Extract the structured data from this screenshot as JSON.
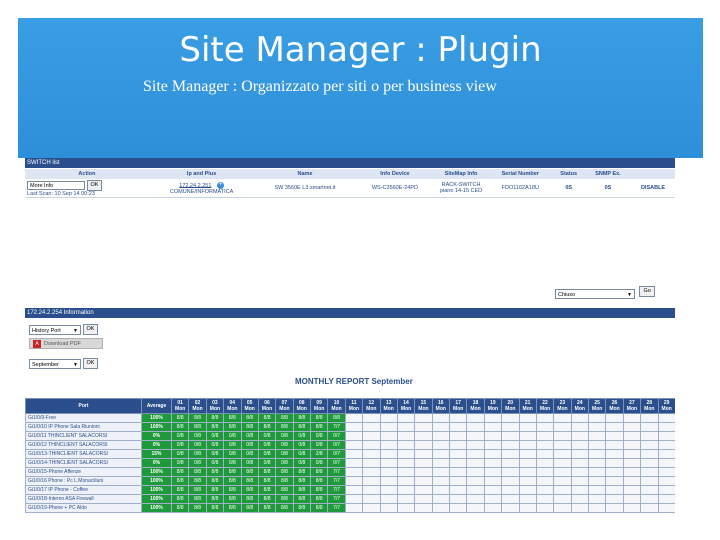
{
  "slide": {
    "title": "Site Manager : Plugin",
    "subtitle": "Site Manager   : Organizzato per siti o per business view"
  },
  "device_panel": {
    "title": "SWITCH list",
    "headers": [
      "Action",
      "Ip and Plus",
      "Name",
      "Info Device",
      "SiteMap Info",
      "Serial Number",
      "Status",
      "SNMP Ex.",
      ""
    ],
    "row": {
      "action_select": "More Info",
      "ok_label": "OK",
      "last_scan": "Last Scan: 10 Sep 14  00:23",
      "ip": "172.24.2.251",
      "ip_sub": "COMUNE/INFORMATICA",
      "name": "SW 3560E L3.smartnet.it",
      "info_device": "WS-C3560E-24PD",
      "sitemap_info": "RACK-SWITCH piano 14-15 CED",
      "serial": "FDO1102A18U",
      "status": "0S",
      "snmp": "0S",
      "extra": "DISABLE"
    },
    "group_select": "Chiuso",
    "go_label": "Go"
  },
  "info_panel": {
    "title": "172.24.2.254 Information",
    "history_select": "History Port",
    "history_ok": "OK",
    "pdf_label": "Download PDF",
    "month_select": "September",
    "month_ok": "OK",
    "report_title": "MONTHLY REPORT   September",
    "port_header": "Port",
    "avg_header": "Average",
    "days": [
      "01",
      "02",
      "03",
      "04",
      "05",
      "06",
      "07",
      "08",
      "09",
      "10",
      "11",
      "12",
      "13",
      "14",
      "15",
      "16",
      "17",
      "18",
      "19",
      "20",
      "21",
      "22",
      "23",
      "24",
      "25",
      "26",
      "27",
      "28",
      "29"
    ],
    "day_sub": "Mon",
    "rows": [
      {
        "port": "Gi1/0/9-Free",
        "avg": "100%",
        "vals": [
          "8/8",
          "8/8",
          "8/8",
          "8/8",
          "8/8",
          "8/8",
          "8/8",
          "8/8",
          "8/8",
          "8/8"
        ]
      },
      {
        "port": "Gi1/0/10 IP Phone Sala Riunioni",
        "avg": "100%",
        "vals": [
          "8/8",
          "8/8",
          "8/8",
          "8/8",
          "8/8",
          "8/8",
          "8/8",
          "8/8",
          "8/8",
          "7/7"
        ]
      },
      {
        "port": "Gi1/0/11 THINCLIENT SALACORSI",
        "avg": "0%",
        "vals": [
          "0/8",
          "0/8",
          "0/8",
          "0/8",
          "0/8",
          "0/8",
          "0/8",
          "0/8",
          "0/8",
          "0/7"
        ]
      },
      {
        "port": "Gi1/0/12 THINCLIENT SALACORSI",
        "avg": "0%",
        "vals": [
          "0/8",
          "0/8",
          "0/8",
          "0/8",
          "0/8",
          "0/8",
          "0/8",
          "0/8",
          "0/8",
          "0/7"
        ]
      },
      {
        "port": "Gi1/0/13-THINCLIENT SALACORSI",
        "avg": "15%",
        "vals": [
          "0/8",
          "0/8",
          "0/8",
          "0/8",
          "0/8",
          "0/8",
          "0/8",
          "0/8",
          "2/8",
          "0/7"
        ]
      },
      {
        "port": "Gi1/0/14-THINCLIENT SALACORSI",
        "avg": "0%",
        "vals": [
          "0/8",
          "0/8",
          "0/8",
          "0/8",
          "0/8",
          "0/8",
          "0/8",
          "0/8",
          "0/8",
          "0/7"
        ]
      },
      {
        "port": "Gi1/0/15-Phone Affenze",
        "avg": "100%",
        "vals": [
          "8/8",
          "8/8",
          "8/8",
          "8/8",
          "8/8",
          "8/8",
          "8/8",
          "8/8",
          "8/8",
          "7/7"
        ]
      },
      {
        "port": "Gi1/0/16 Phone : Pc L.Monaciliuni",
        "avg": "100%",
        "vals": [
          "8/8",
          "8/8",
          "8/8",
          "8/8",
          "8/8",
          "8/8",
          "8/8",
          "8/8",
          "8/8",
          "7/7"
        ]
      },
      {
        "port": "Gi1/0/17 IP Phone - Coffee",
        "avg": "100%",
        "vals": [
          "8/8",
          "8/8",
          "8/8",
          "8/8",
          "8/8",
          "8/8",
          "8/8",
          "8/8",
          "8/8",
          "7/7"
        ]
      },
      {
        "port": "Gi1/0/18-Interno ASA Firewall",
        "avg": "100%",
        "vals": [
          "8/8",
          "8/8",
          "8/8",
          "8/8",
          "8/8",
          "8/8",
          "8/8",
          "8/8",
          "8/8",
          "7/7"
        ]
      },
      {
        "port": "Gi1/0/19-Phone + PC Aldo",
        "avg": "100%",
        "vals": [
          "8/8",
          "8/8",
          "8/8",
          "8/8",
          "8/8",
          "8/8",
          "8/8",
          "8/8",
          "8/8",
          "7/7"
        ]
      }
    ]
  }
}
